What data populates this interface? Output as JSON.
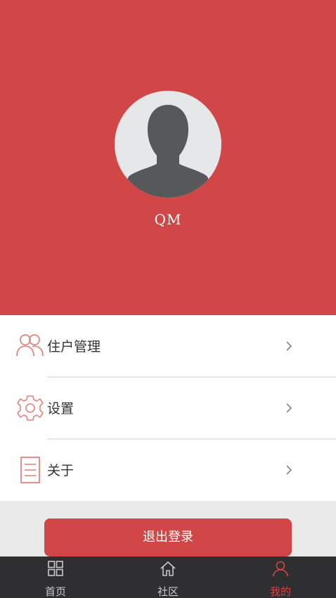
{
  "profile": {
    "username": "QM"
  },
  "menu": {
    "items": [
      {
        "label": "住户管理",
        "icon": "residents-icon"
      },
      {
        "label": "设置",
        "icon": "gear-icon"
      },
      {
        "label": "关于",
        "icon": "document-icon"
      }
    ]
  },
  "actions": {
    "logout_label": "退出登录"
  },
  "tabbar": {
    "items": [
      {
        "label": "首页",
        "icon": "grid-icon",
        "active": false
      },
      {
        "label": "社区",
        "icon": "home-icon",
        "active": false
      },
      {
        "label": "我的",
        "icon": "person-icon",
        "active": true
      }
    ]
  },
  "colors": {
    "primary": "#d14646",
    "tabbar_bg": "#2f2f31",
    "page_bg": "#eaeaea"
  }
}
